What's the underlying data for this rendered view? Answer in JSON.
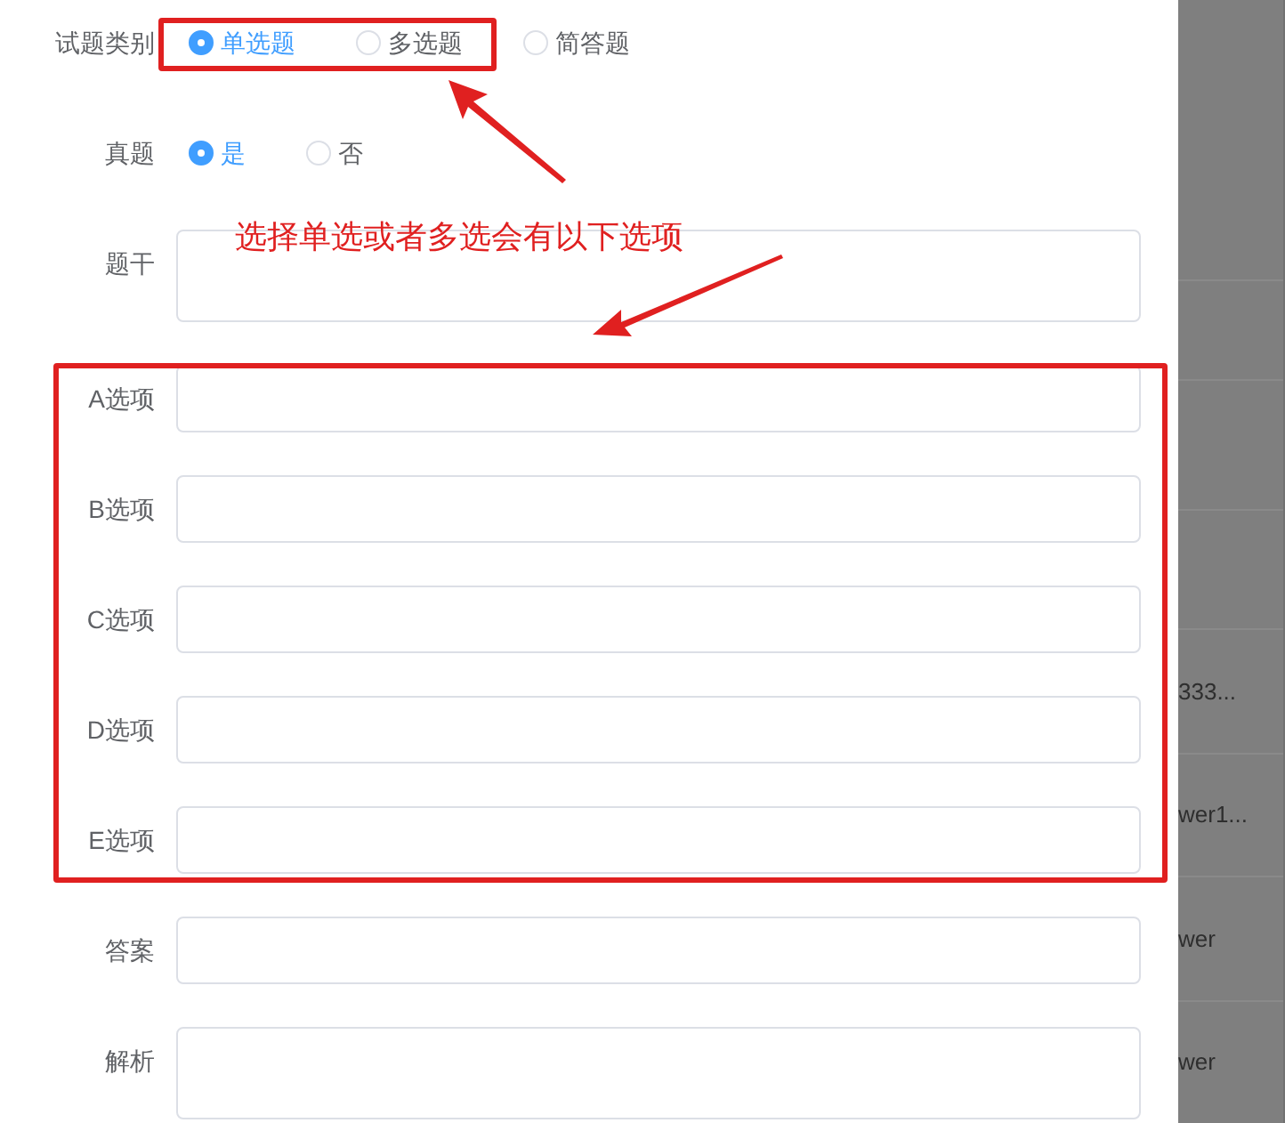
{
  "form": {
    "fields": [
      {
        "label": "试题类别",
        "kind": "radio",
        "options": [
          {
            "label": "单选题",
            "selected": true
          },
          {
            "label": "多选题",
            "selected": false
          },
          {
            "label": "简答题",
            "selected": false
          }
        ]
      },
      {
        "label": "真题",
        "kind": "radio",
        "options": [
          {
            "label": "是",
            "selected": true
          },
          {
            "label": "否",
            "selected": false
          }
        ]
      },
      {
        "label": "题干",
        "kind": "textarea"
      },
      {
        "label": "A选项",
        "kind": "input"
      },
      {
        "label": "B选项",
        "kind": "input"
      },
      {
        "label": "C选项",
        "kind": "input"
      },
      {
        "label": "D选项",
        "kind": "input"
      },
      {
        "label": "E选项",
        "kind": "input"
      },
      {
        "label": "答案",
        "kind": "input"
      },
      {
        "label": "解析",
        "kind": "textarea"
      }
    ]
  },
  "background_table": {
    "cells": [
      "333...",
      "wer1...",
      "wer",
      "wer"
    ]
  },
  "annotation": {
    "text": "选择单选或者多选会有以下选项"
  }
}
